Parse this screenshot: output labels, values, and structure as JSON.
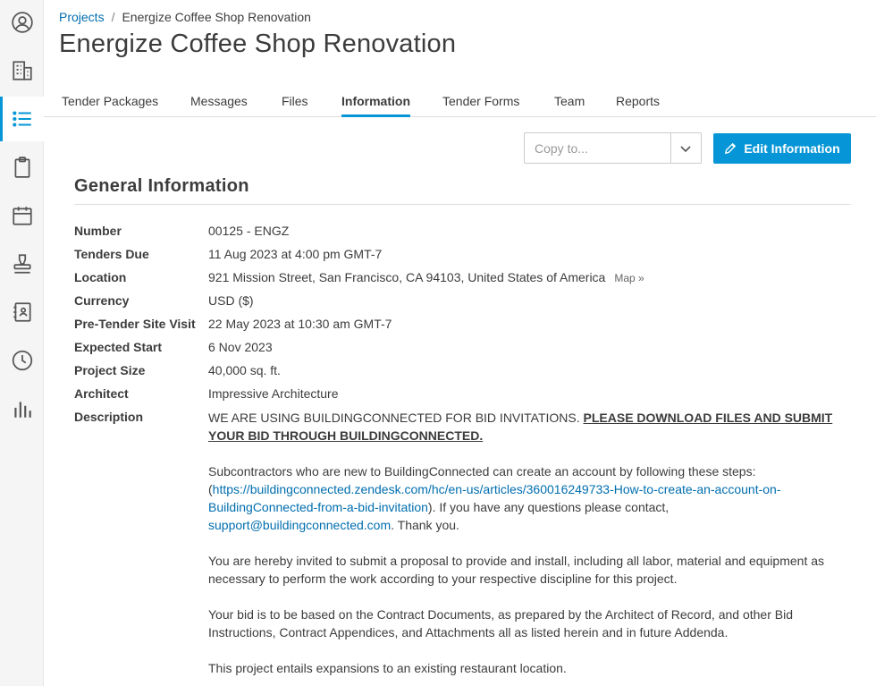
{
  "sidebar": {
    "items": [
      {
        "icon": "user-circle-icon"
      },
      {
        "icon": "building-icon"
      },
      {
        "icon": "list-icon",
        "active": true
      },
      {
        "icon": "clipboard-icon"
      },
      {
        "icon": "calendar-icon"
      },
      {
        "icon": "stamp-icon"
      },
      {
        "icon": "address-book-icon"
      },
      {
        "icon": "clock-icon"
      },
      {
        "icon": "bar-chart-icon"
      }
    ]
  },
  "breadcrumb": {
    "parent": "Projects",
    "separator": "/",
    "current": "Energize Coffee Shop Renovation"
  },
  "page_title": "Energize Coffee Shop Renovation",
  "tabs": [
    "Tender Packages",
    "Messages",
    "Files",
    "Information",
    "Tender Forms",
    "Team",
    "Reports"
  ],
  "active_tab": "Information",
  "actions": {
    "copy_placeholder": "Copy to...",
    "edit_label": "Edit Information"
  },
  "section_title": "General Information",
  "fields": [
    {
      "label": "Number",
      "value": "00125 - ENGZ"
    },
    {
      "label": "Tenders Due",
      "value": "11 Aug 2023 at 4:00 pm GMT-7"
    },
    {
      "label": "Location",
      "value": "921 Mission Street, San Francisco, CA 94103, United States of America"
    },
    {
      "label": "Currency",
      "value": "USD ($)"
    },
    {
      "label": "Pre-Tender Site Visit",
      "value": "22 May 2023 at 10:30 am GMT-7"
    },
    {
      "label": "Expected Start",
      "value": "6 Nov 2023"
    },
    {
      "label": "Project Size",
      "value": "40,000 sq. ft."
    },
    {
      "label": "Architect",
      "value": "Impressive Architecture"
    },
    {
      "label": "Description",
      "value": ""
    }
  ],
  "map_link": "Map »",
  "description": {
    "p1_plain": "WE ARE USING BUILDINGCONNECTED FOR BID INVITATIONS. ",
    "p1_bold": "PLEASE DOWNLOAD FILES AND SUBMIT YOUR BID THROUGH BUILDINGCONNECTED.",
    "p2_intro": "Subcontractors who are new to BuildingConnected can create an account by following these steps: (",
    "p2_link": "https://buildingconnected.zendesk.com/hc/en-us/articles/360016249733-How-to-create-an-account-on-BuildingConnected-from-a-bid-invitation",
    "p2_mid": "). If you have any questions please contact, ",
    "p2_email": "support@buildingconnected.com",
    "p2_end": ". Thank you.",
    "p3": "You are hereby invited to submit a proposal to provide and install, including all labor, material and equipment as necessary to perform the work according to your respective discipline for this project.",
    "p4": "Your bid is to be based on the Contract Documents, as prepared by the Architect of Record, and other Bid Instructions, Contract Appendices, and Attachments all as listed herein and in future Addenda.",
    "p5": "This project entails expansions to an existing restaurant location."
  },
  "colors": {
    "accent": "#0696d7",
    "link": "#006eaf",
    "text": "#3c3c3c"
  }
}
